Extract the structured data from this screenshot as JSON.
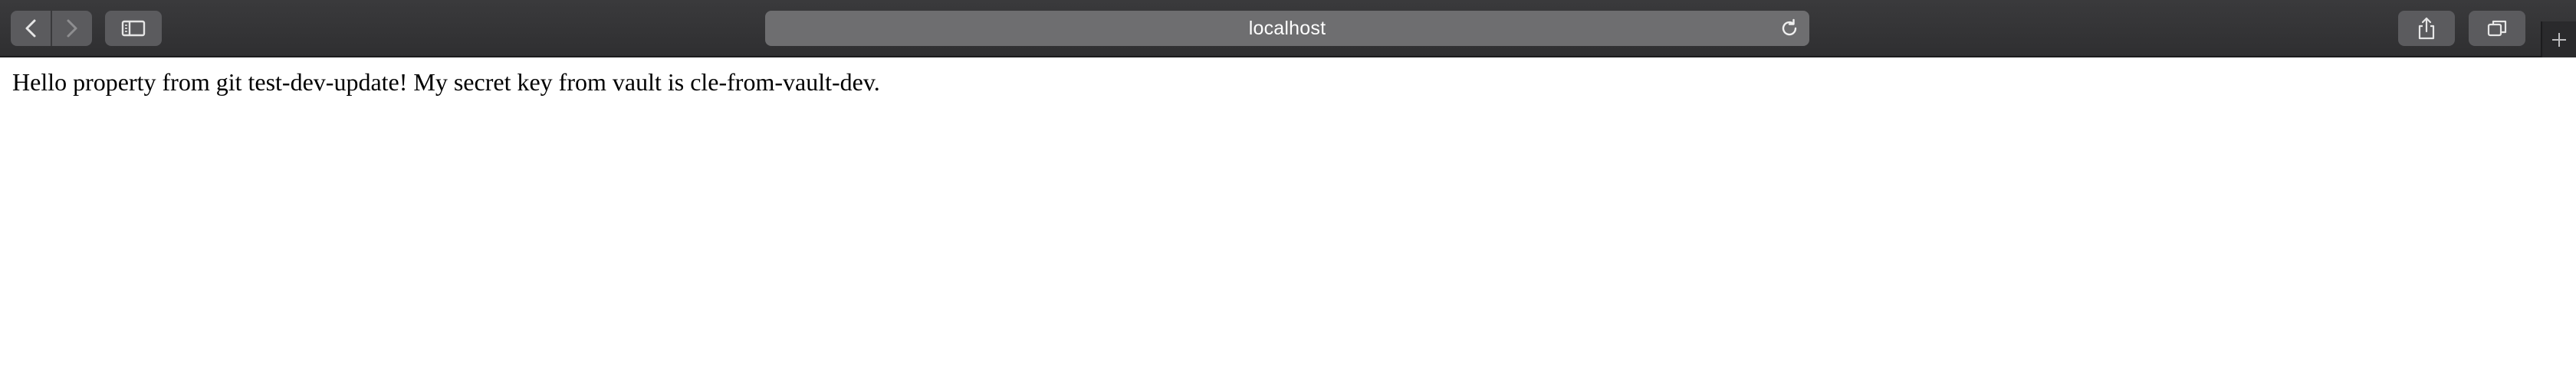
{
  "browser": {
    "address": "localhost",
    "icons": {
      "back": "chevron-left-icon",
      "forward": "chevron-right-icon",
      "sidebar": "sidebar-icon",
      "reload": "reload-icon",
      "share": "share-icon",
      "tabs": "tabs-overview-icon",
      "new_tab": "plus-icon"
    },
    "colors": {
      "toolbar": "#3a3a3c",
      "button": "#5b5b5e",
      "address_bar": "#6e6e70"
    }
  },
  "page": {
    "message": "Hello property from git test-dev-update! My secret key from vault is cle-from-vault-dev."
  }
}
